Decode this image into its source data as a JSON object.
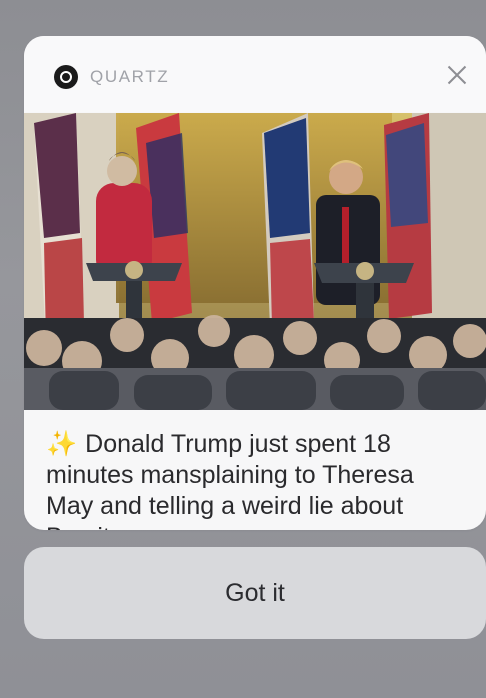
{
  "notification": {
    "app_name": "QUARTZ",
    "app_icon": "quartz-logo-icon",
    "close_icon": "close-icon",
    "image_description": "",
    "emoji": "✨",
    "message": "Donald Trump just spent 18 minutes mansplaining to Theresa May and telling a weird lie about Brexit."
  },
  "action": {
    "label": "Got it"
  }
}
